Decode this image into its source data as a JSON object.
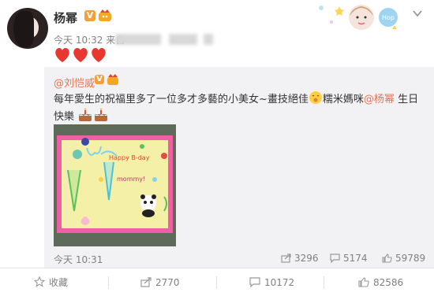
{
  "post": {
    "author": "杨幂",
    "verified_badge": "V",
    "time_prefix": "今天 10:32 来自",
    "hearts_icon": "three-red-hearts"
  },
  "repost": {
    "mention_author": "@刘恺威",
    "verified_badge": "V",
    "text_part1": "每年愛生的祝福里多了一位多才多藝的小美女~畫技絕佳",
    "text_part2": "糯米媽咪",
    "mention_inline": "@杨幂",
    "text_part3": " 生日快樂",
    "photo_text_line1": "Happy B-day",
    "photo_text_line2": "mommy!",
    "time": "今天 10:31",
    "stats": {
      "reposts": "3296",
      "comments": "5174",
      "likes": "59789"
    }
  },
  "actions": {
    "favorite": "收藏",
    "repost": "2770",
    "comment": "10172",
    "like": "82586"
  },
  "colors": {
    "mention": "#eb7350",
    "badge": "#f2a03a",
    "muted": "#808080",
    "repost_bg": "#f2f2f5"
  }
}
